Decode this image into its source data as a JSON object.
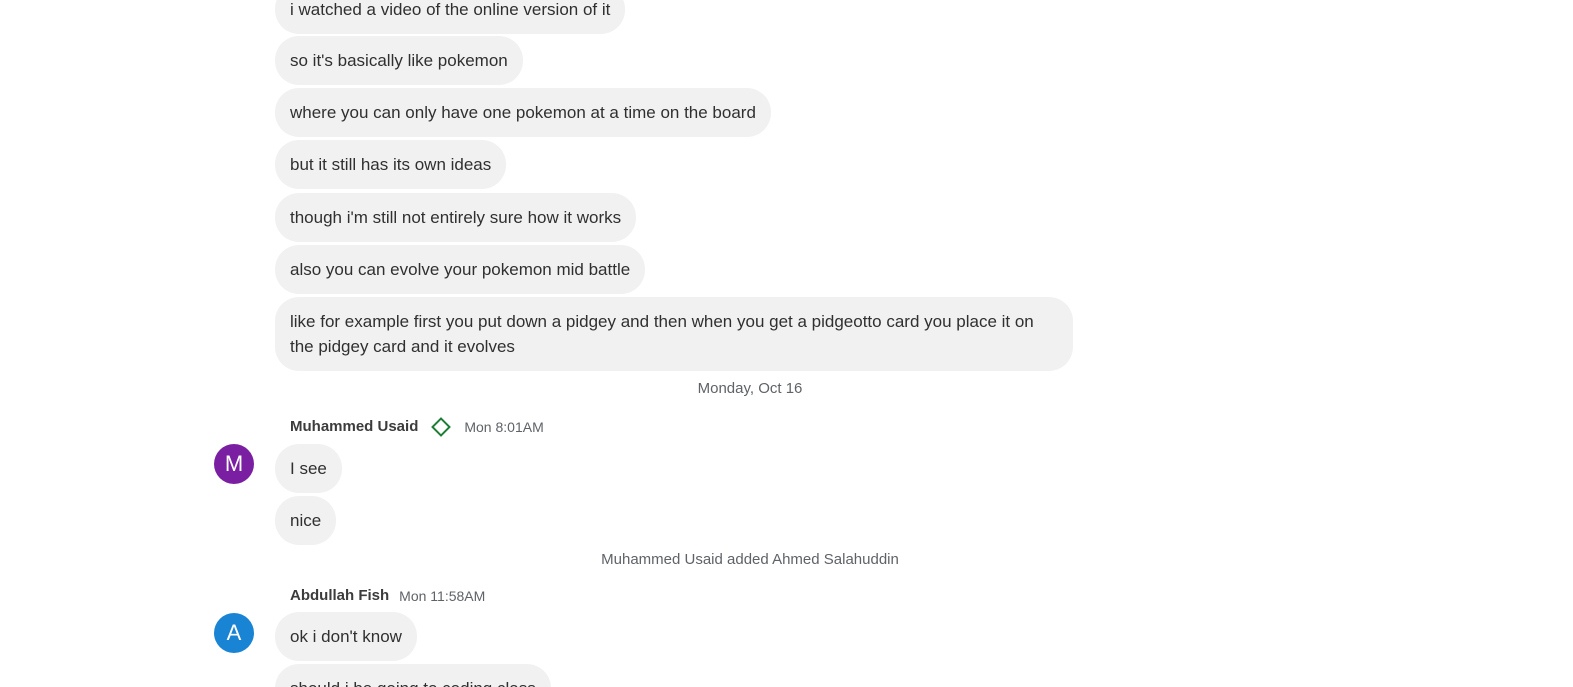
{
  "messages_top": [
    {
      "text": "i watched a video of the online version of it"
    },
    {
      "text": "so it's basically like pokemon"
    },
    {
      "text": "where you can only have one pokemon at a time on the board"
    },
    {
      "text": "but it still has its own ideas"
    },
    {
      "text": "though i'm still not entirely sure how it works"
    },
    {
      "text": "also you can evolve your pokemon mid battle"
    },
    {
      "text": "like for example first you put down a pidgey and then when you get a pidgeotto card you place it on the pidgey card and it evolves"
    }
  ],
  "date_divider": "Monday, Oct 16",
  "group1": {
    "sender": "Muhammed Usaid",
    "time": "Mon 8:01AM",
    "avatar_letter": "M",
    "avatar_color": "#7b1fa2",
    "badge_icon": "diamond-icon",
    "messages": [
      "I see",
      "nice"
    ]
  },
  "system_event": "Muhammed Usaid added Ahmed Salahuddin",
  "group2": {
    "sender": "Abdullah Fish",
    "time": "Mon 11:58AM",
    "avatar_letter": "A",
    "avatar_color": "#1a84d4",
    "messages": [
      "ok i don't know",
      "should i be going to coding class"
    ]
  }
}
